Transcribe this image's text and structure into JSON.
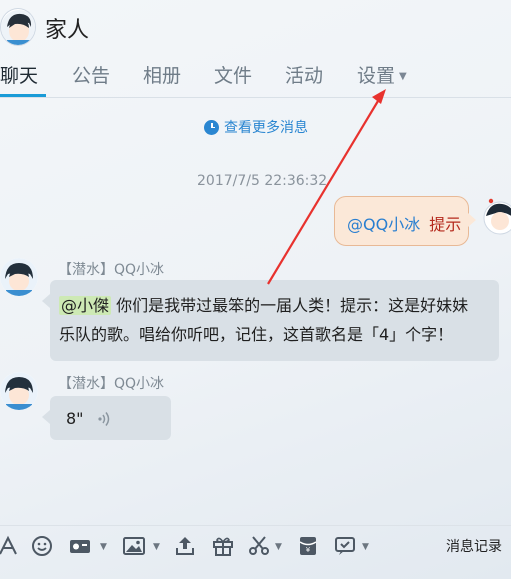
{
  "header": {
    "group_name": "家人"
  },
  "tabs": [
    {
      "label": "聊天"
    },
    {
      "label": "公告"
    },
    {
      "label": "相册"
    },
    {
      "label": "文件"
    },
    {
      "label": "活动"
    },
    {
      "label": "设置"
    }
  ],
  "chat": {
    "more_messages": "查看更多消息",
    "timestamp": "2017/7/5 22:36:32",
    "my_message": {
      "mention": "@QQ小冰",
      "text": "提示"
    },
    "messages": [
      {
        "sender": "【潜水】QQ小冰",
        "mention": "@小傑",
        "line1": " 你们是我带过最笨的一届人类！提示：这是好妹妹",
        "line2": "乐队的歌。唱给你听吧，记住，这首歌名是「4」个字！"
      },
      {
        "sender": "【潜水】QQ小冰",
        "voice_duration": "8\""
      }
    ]
  },
  "toolbar": {
    "icons": [
      "font-icon",
      "emoji-icon",
      "screen-share-icon",
      "image-icon",
      "upload-icon",
      "gift-icon",
      "scissors-icon",
      "red-packet-icon",
      "bot-icon"
    ],
    "history_label": "消息记录"
  },
  "colors": {
    "accent": "#1a9bd7",
    "my_bubble": "#fbe8d8",
    "bot_bubble": "#d9e0e6",
    "annotation": "#e8322e"
  }
}
